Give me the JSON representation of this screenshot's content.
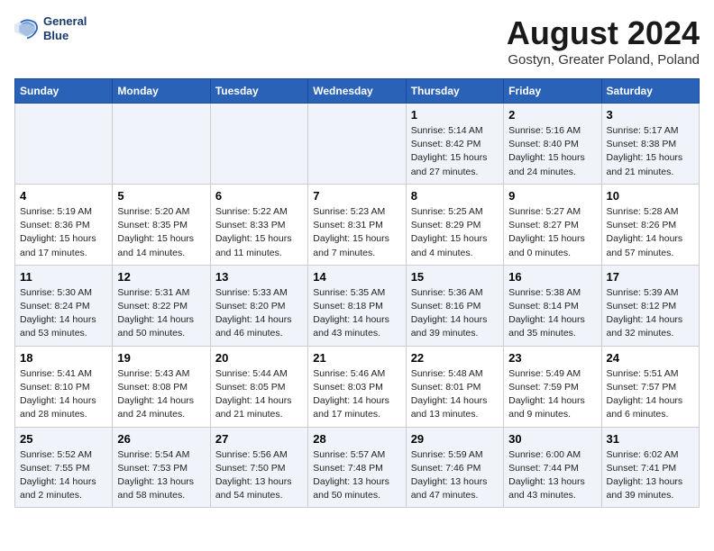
{
  "header": {
    "logo_line1": "General",
    "logo_line2": "Blue",
    "main_title": "August 2024",
    "subtitle": "Gostyn, Greater Poland, Poland"
  },
  "days_of_week": [
    "Sunday",
    "Monday",
    "Tuesday",
    "Wednesday",
    "Thursday",
    "Friday",
    "Saturday"
  ],
  "weeks": [
    [
      {
        "day": "",
        "info": ""
      },
      {
        "day": "",
        "info": ""
      },
      {
        "day": "",
        "info": ""
      },
      {
        "day": "",
        "info": ""
      },
      {
        "day": "1",
        "info": "Sunrise: 5:14 AM\nSunset: 8:42 PM\nDaylight: 15 hours\nand 27 minutes."
      },
      {
        "day": "2",
        "info": "Sunrise: 5:16 AM\nSunset: 8:40 PM\nDaylight: 15 hours\nand 24 minutes."
      },
      {
        "day": "3",
        "info": "Sunrise: 5:17 AM\nSunset: 8:38 PM\nDaylight: 15 hours\nand 21 minutes."
      }
    ],
    [
      {
        "day": "4",
        "info": "Sunrise: 5:19 AM\nSunset: 8:36 PM\nDaylight: 15 hours\nand 17 minutes."
      },
      {
        "day": "5",
        "info": "Sunrise: 5:20 AM\nSunset: 8:35 PM\nDaylight: 15 hours\nand 14 minutes."
      },
      {
        "day": "6",
        "info": "Sunrise: 5:22 AM\nSunset: 8:33 PM\nDaylight: 15 hours\nand 11 minutes."
      },
      {
        "day": "7",
        "info": "Sunrise: 5:23 AM\nSunset: 8:31 PM\nDaylight: 15 hours\nand 7 minutes."
      },
      {
        "day": "8",
        "info": "Sunrise: 5:25 AM\nSunset: 8:29 PM\nDaylight: 15 hours\nand 4 minutes."
      },
      {
        "day": "9",
        "info": "Sunrise: 5:27 AM\nSunset: 8:27 PM\nDaylight: 15 hours\nand 0 minutes."
      },
      {
        "day": "10",
        "info": "Sunrise: 5:28 AM\nSunset: 8:26 PM\nDaylight: 14 hours\nand 57 minutes."
      }
    ],
    [
      {
        "day": "11",
        "info": "Sunrise: 5:30 AM\nSunset: 8:24 PM\nDaylight: 14 hours\nand 53 minutes."
      },
      {
        "day": "12",
        "info": "Sunrise: 5:31 AM\nSunset: 8:22 PM\nDaylight: 14 hours\nand 50 minutes."
      },
      {
        "day": "13",
        "info": "Sunrise: 5:33 AM\nSunset: 8:20 PM\nDaylight: 14 hours\nand 46 minutes."
      },
      {
        "day": "14",
        "info": "Sunrise: 5:35 AM\nSunset: 8:18 PM\nDaylight: 14 hours\nand 43 minutes."
      },
      {
        "day": "15",
        "info": "Sunrise: 5:36 AM\nSunset: 8:16 PM\nDaylight: 14 hours\nand 39 minutes."
      },
      {
        "day": "16",
        "info": "Sunrise: 5:38 AM\nSunset: 8:14 PM\nDaylight: 14 hours\nand 35 minutes."
      },
      {
        "day": "17",
        "info": "Sunrise: 5:39 AM\nSunset: 8:12 PM\nDaylight: 14 hours\nand 32 minutes."
      }
    ],
    [
      {
        "day": "18",
        "info": "Sunrise: 5:41 AM\nSunset: 8:10 PM\nDaylight: 14 hours\nand 28 minutes."
      },
      {
        "day": "19",
        "info": "Sunrise: 5:43 AM\nSunset: 8:08 PM\nDaylight: 14 hours\nand 24 minutes."
      },
      {
        "day": "20",
        "info": "Sunrise: 5:44 AM\nSunset: 8:05 PM\nDaylight: 14 hours\nand 21 minutes."
      },
      {
        "day": "21",
        "info": "Sunrise: 5:46 AM\nSunset: 8:03 PM\nDaylight: 14 hours\nand 17 minutes."
      },
      {
        "day": "22",
        "info": "Sunrise: 5:48 AM\nSunset: 8:01 PM\nDaylight: 14 hours\nand 13 minutes."
      },
      {
        "day": "23",
        "info": "Sunrise: 5:49 AM\nSunset: 7:59 PM\nDaylight: 14 hours\nand 9 minutes."
      },
      {
        "day": "24",
        "info": "Sunrise: 5:51 AM\nSunset: 7:57 PM\nDaylight: 14 hours\nand 6 minutes."
      }
    ],
    [
      {
        "day": "25",
        "info": "Sunrise: 5:52 AM\nSunset: 7:55 PM\nDaylight: 14 hours\nand 2 minutes."
      },
      {
        "day": "26",
        "info": "Sunrise: 5:54 AM\nSunset: 7:53 PM\nDaylight: 13 hours\nand 58 minutes."
      },
      {
        "day": "27",
        "info": "Sunrise: 5:56 AM\nSunset: 7:50 PM\nDaylight: 13 hours\nand 54 minutes."
      },
      {
        "day": "28",
        "info": "Sunrise: 5:57 AM\nSunset: 7:48 PM\nDaylight: 13 hours\nand 50 minutes."
      },
      {
        "day": "29",
        "info": "Sunrise: 5:59 AM\nSunset: 7:46 PM\nDaylight: 13 hours\nand 47 minutes."
      },
      {
        "day": "30",
        "info": "Sunrise: 6:00 AM\nSunset: 7:44 PM\nDaylight: 13 hours\nand 43 minutes."
      },
      {
        "day": "31",
        "info": "Sunrise: 6:02 AM\nSunset: 7:41 PM\nDaylight: 13 hours\nand 39 minutes."
      }
    ]
  ]
}
